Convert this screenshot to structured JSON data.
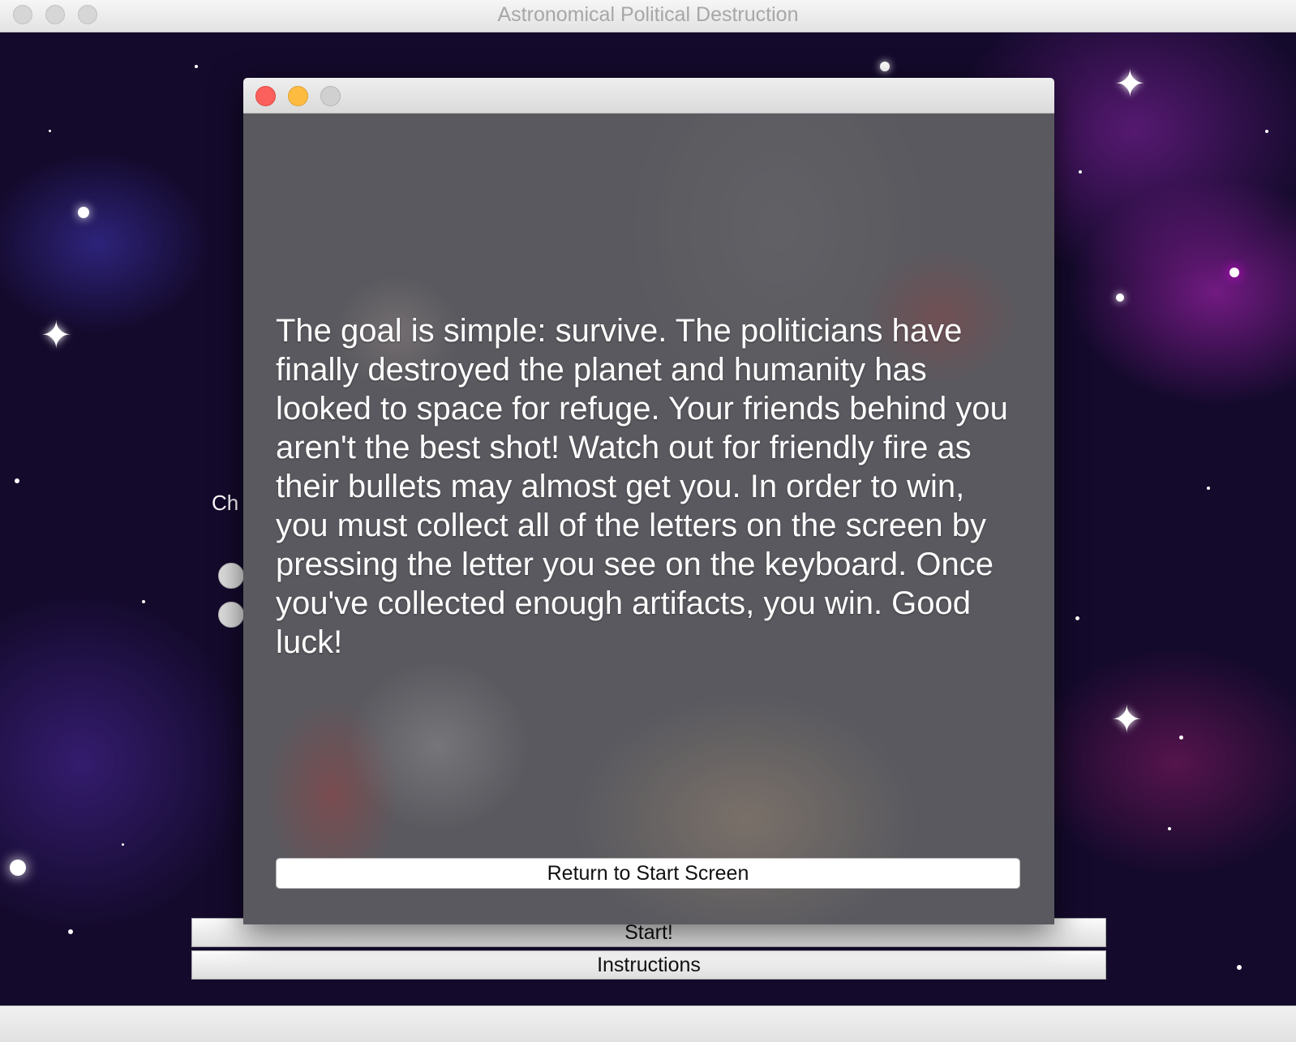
{
  "window": {
    "title": "Astronomical Political Destruction"
  },
  "start_screen": {
    "partial_label": "Ch",
    "start_label": "Start!",
    "instructions_label": "Instructions"
  },
  "instructions_dialog": {
    "text": "The goal is simple: survive. The politicians have finally destroyed the planet and humanity has looked to space for refuge. Your friends behind you aren't the best shot! Watch out for friendly fire as their bullets may almost get you. In order to win, you must collect all of the letters on the screen by pressing the letter you see on the keyboard. Once you've collected enough artifacts, you win. Good luck!",
    "return_label": "Return to Start Screen"
  },
  "colors": {
    "close": "#fc605c",
    "minimize": "#fdbc40",
    "zoom_inactive": "#d0d0d0"
  }
}
